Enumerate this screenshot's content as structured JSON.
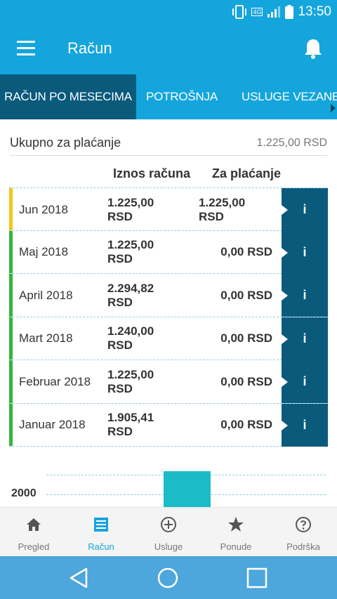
{
  "status_bar": {
    "time": "13:50",
    "network": "4G"
  },
  "app_bar": {
    "title": "Račun"
  },
  "tabs": [
    {
      "label": "RAČUN PO MESECIMA",
      "active": true
    },
    {
      "label": "POTROŠNJA",
      "active": false
    },
    {
      "label": "USLUGE VEZANE ZA",
      "active": false
    }
  ],
  "summary": {
    "label": "Ukupno za plaćanje",
    "value": "1.225,00 RSD"
  },
  "columns": {
    "amount": "Iznos računa",
    "to_pay": "Za plaćanje"
  },
  "bills": [
    {
      "month": "Jun 2018",
      "amount": "1.225,00 RSD",
      "to_pay": "1.225,00 RSD",
      "status_color": "#f5c518",
      "info": "i"
    },
    {
      "month": "Maj 2018",
      "amount": "1.225,00 RSD",
      "to_pay": "0,00 RSD",
      "status_color": "#2eb83a",
      "info": "i"
    },
    {
      "month": "April 2018",
      "amount": "2.294,82 RSD",
      "to_pay": "0,00 RSD",
      "status_color": "#2eb83a",
      "info": "i"
    },
    {
      "month": "Mart 2018",
      "amount": "1.240,00 RSD",
      "to_pay": "0,00 RSD",
      "status_color": "#2eb83a",
      "info": "i"
    },
    {
      "month": "Februar 2018",
      "amount": "1.225,00 RSD",
      "to_pay": "0,00 RSD",
      "status_color": "#2eb83a",
      "info": "i"
    },
    {
      "month": "Januar 2018",
      "amount": "1.905,41 RSD",
      "to_pay": "0,00 RSD",
      "status_color": "#2eb83a",
      "info": "i"
    }
  ],
  "chart_data": {
    "type": "bar",
    "y_tick_labels": [
      "2000"
    ],
    "bar_color": "#1bbcc8"
  },
  "bottom_nav": [
    {
      "label": "Pregled",
      "icon": "home-icon",
      "active": false
    },
    {
      "label": "Račun",
      "icon": "bill-icon",
      "active": true
    },
    {
      "label": "Usluge",
      "icon": "plus-circle-icon",
      "active": false
    },
    {
      "label": "Ponude",
      "icon": "star-icon",
      "active": false
    },
    {
      "label": "Podrška",
      "icon": "help-circle-icon",
      "active": false
    }
  ],
  "colors": {
    "primary": "#14a5dc",
    "dark": "#0a5a7c",
    "accent_bar": "#1bbcc8"
  }
}
